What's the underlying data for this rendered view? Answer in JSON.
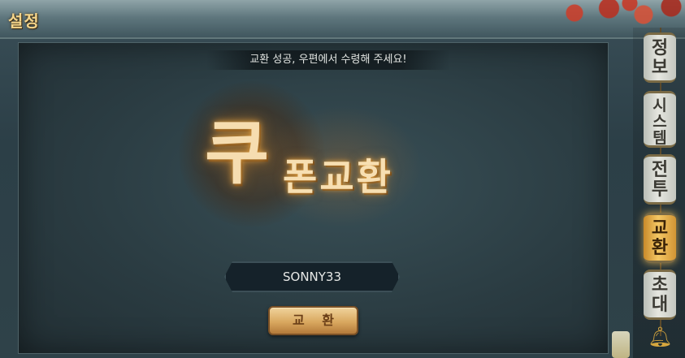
{
  "header": {
    "title": "설정"
  },
  "notice": {
    "text": "교환 성공, 우편에서 수령해 주세요!"
  },
  "logo": {
    "big_char": "쿠",
    "rest": "폰교환"
  },
  "coupon": {
    "value": "SONNY33"
  },
  "actions": {
    "exchange_label": "교 환"
  },
  "sidebar": {
    "tabs": [
      {
        "line1": "정",
        "line2": "보"
      },
      {
        "line1": "시",
        "line2": "스",
        "line3": "템"
      },
      {
        "line1": "전",
        "line2": "투"
      },
      {
        "line1": "교",
        "line2": "환",
        "active": true
      },
      {
        "line1": "초",
        "line2": "대"
      }
    ],
    "bell_icon": "bell-icon"
  },
  "colors": {
    "accent_gold": "#f3d48a",
    "active_tab": "#f4c764"
  }
}
